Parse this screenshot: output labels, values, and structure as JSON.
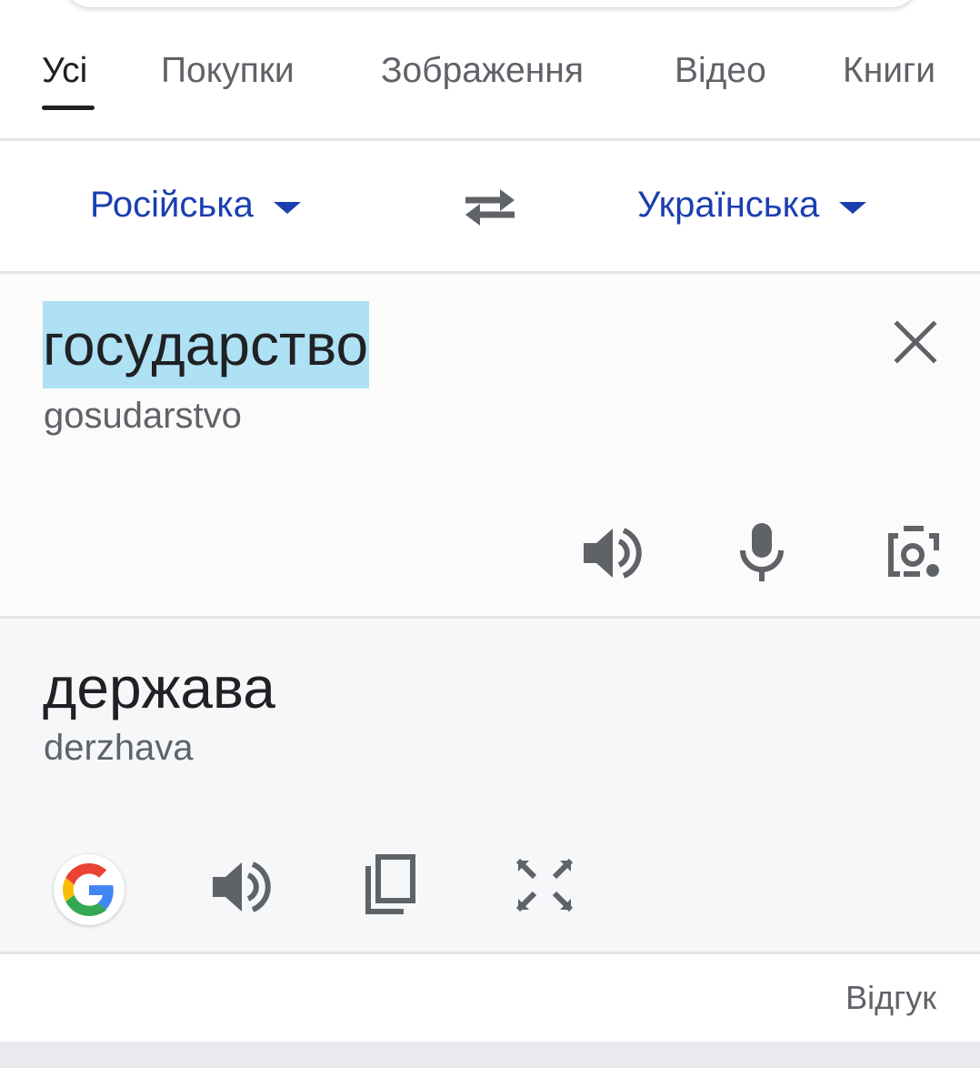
{
  "tabs": [
    {
      "label": "Усі",
      "active": true
    },
    {
      "label": "Покупки",
      "active": false
    },
    {
      "label": "Зображення",
      "active": false
    },
    {
      "label": "Відео",
      "active": false
    },
    {
      "label": "Книги",
      "active": false
    }
  ],
  "languages": {
    "source": "Російська",
    "target": "Українська"
  },
  "source": {
    "text": "государство",
    "transliteration": "gosudarstvo"
  },
  "target": {
    "text": "держава",
    "transliteration": "derzhava"
  },
  "footer": {
    "feedback": "Відгук"
  },
  "colors": {
    "accent_blue": "#1a3fb0",
    "selection_highlight": "#aee1f3",
    "icon_gray": "#5f6368"
  },
  "icons": {
    "source_actions": [
      "speaker-icon",
      "microphone-icon",
      "camera-icon"
    ],
    "target_actions": [
      "google-icon",
      "speaker-icon",
      "copy-icon",
      "fullscreen-icon"
    ]
  }
}
